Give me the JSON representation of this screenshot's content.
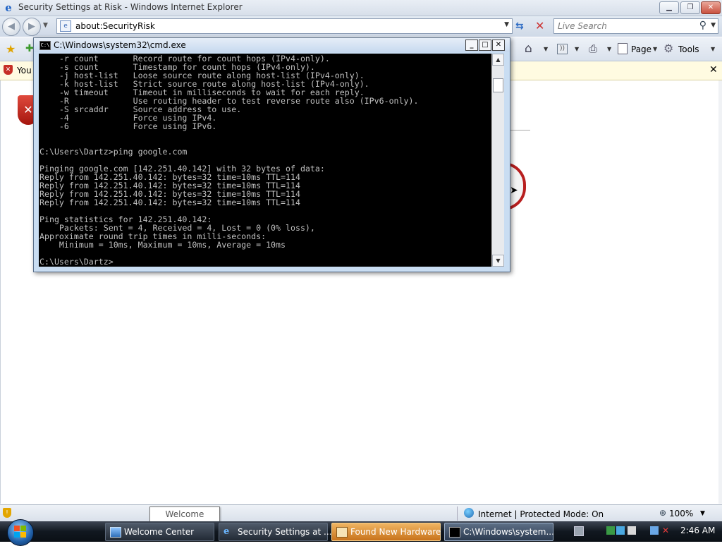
{
  "ie": {
    "title": "Security Settings at Risk - Windows Internet Explorer",
    "address": "about:SecurityRisk",
    "search_placeholder": "Live Search",
    "page_label": "Page",
    "tools_label": "Tools",
    "infobar_text": "You",
    "zone_text": "Internet | Protected Mode: On",
    "zoom": "100%"
  },
  "cmd": {
    "title": "C:\\Windows\\system32\\cmd.exe",
    "output": "    -r count       Record route for count hops (IPv4-only).\n    -s count       Timestamp for count hops (IPv4-only).\n    -j host-list   Loose source route along host-list (IPv4-only).\n    -k host-list   Strict source route along host-list (IPv4-only).\n    -w timeout     Timeout in milliseconds to wait for each reply.\n    -R             Use routing header to test reverse route also (IPv6-only).\n    -S srcaddr     Source address to use.\n    -4             Force using IPv4.\n    -6             Force using IPv6.\n\n\nC:\\Users\\Dartz>ping google.com\n\nPinging google.com [142.251.40.142] with 32 bytes of data:\nReply from 142.251.40.142: bytes=32 time=10ms TTL=114\nReply from 142.251.40.142: bytes=32 time=10ms TTL=114\nReply from 142.251.40.142: bytes=32 time=10ms TTL=114\nReply from 142.251.40.142: bytes=32 time=10ms TTL=114\n\nPing statistics for 142.251.40.142:\n    Packets: Sent = 4, Received = 4, Lost = 0 (0% loss),\nApproximate round trip times in milli-seconds:\n    Minimum = 10ms, Maximum = 10ms, Average = 10ms\n\nC:\\Users\\Dartz>"
  },
  "tooltip": "Welcome Center",
  "taskbar": {
    "items": [
      {
        "label": "Welcome Center",
        "icon": "welcome-center-icon"
      },
      {
        "label": "Security Settings at ...",
        "icon": "ie-icon"
      },
      {
        "label": "Found New Hardware",
        "icon": "hardware-icon"
      },
      {
        "label": "C:\\Windows\\system...",
        "icon": "cmd-icon"
      }
    ],
    "clock": "2:46 AM"
  },
  "colors": {
    "console_bg": "#000000",
    "console_text": "#c0c0c0",
    "security_red": "#b81f1f",
    "taskbar": "#111820"
  }
}
